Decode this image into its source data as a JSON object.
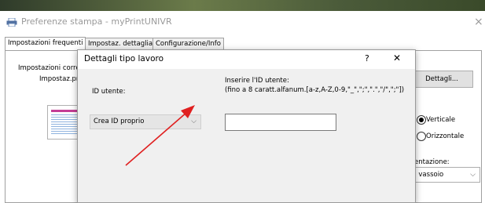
{
  "window": {
    "title": "Preferenze stampa - myPrintUNIVR",
    "close_glyph": "×",
    "icon": "printer-icon"
  },
  "tabs": [
    {
      "label": "Impostazioni frequenti",
      "active": true
    },
    {
      "label": "Impostaz. dettagliate",
      "active": false
    },
    {
      "label": "Configurazione/Info",
      "active": false
    }
  ],
  "background": {
    "current_settings_label": "Impostazioni corren",
    "settings_label": "Impostaz.pre",
    "details_button": "Dettagli...",
    "orientation_options": [
      {
        "label": "Verticale",
        "selected": true
      },
      {
        "label": "Orizzontale",
        "selected": false
      }
    ],
    "orientation_label": "entazione:",
    "tray_value": ", vassoio"
  },
  "dialog": {
    "title": "Dettagli tipo lavoro",
    "help_glyph": "?",
    "close_glyph": "✕",
    "user_id_label": "ID utente:",
    "user_id_select_value": "Crea ID proprio",
    "enter_id_label": "Inserire l'ID utente:",
    "enter_id_hint": "(fino a 8 caratt.alfanum.[a-z,A-Z,0-9,\"_\",\";\",\".\",\"/\",\";\"])",
    "enter_id_value": ""
  },
  "annotation": {
    "arrow_color": "#e02020"
  }
}
